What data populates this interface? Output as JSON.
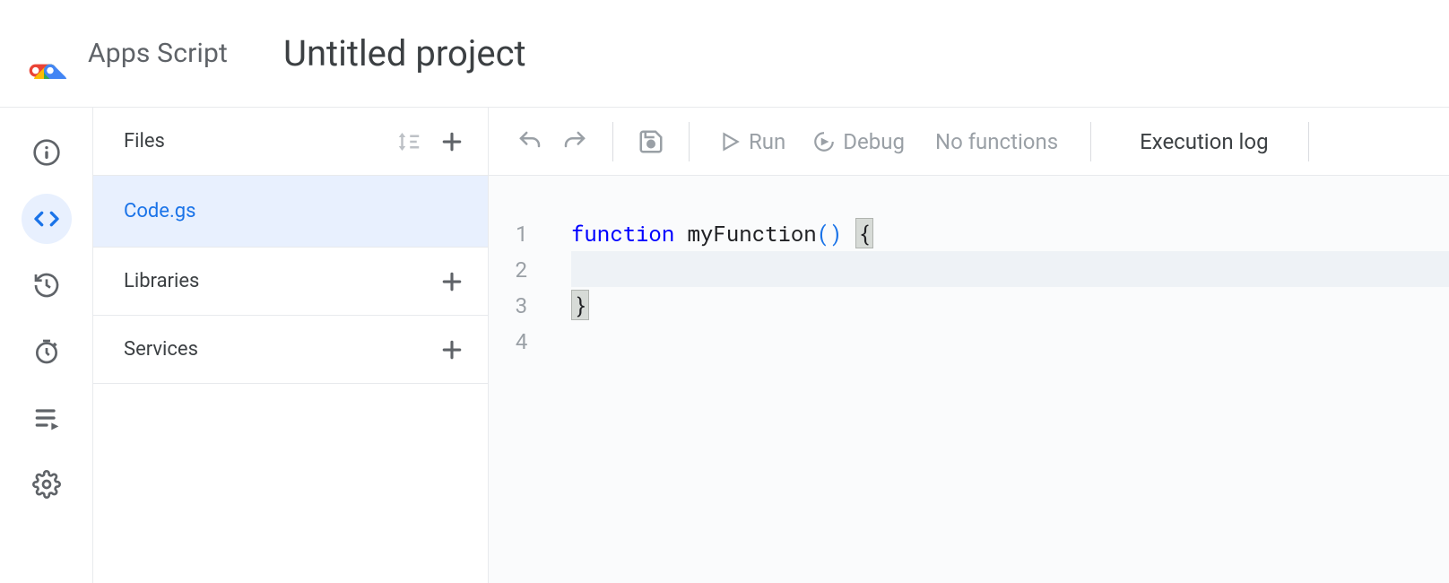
{
  "header": {
    "app_name": "Apps Script",
    "project_title": "Untitled project"
  },
  "nav": {
    "items": [
      "overview",
      "editor",
      "history",
      "triggers",
      "executions",
      "settings"
    ],
    "active": "editor"
  },
  "sidebar": {
    "files_label": "Files",
    "libraries_label": "Libraries",
    "services_label": "Services",
    "files": [
      {
        "name": "Code.gs",
        "selected": true
      }
    ]
  },
  "toolbar": {
    "run_label": "Run",
    "debug_label": "Debug",
    "function_select": "No functions",
    "execution_log_label": "Execution log"
  },
  "editor": {
    "line_numbers": [
      "1",
      "2",
      "3",
      "4"
    ],
    "code": {
      "line1_keyword": "function",
      "line1_name": " myFunction",
      "line1_parens": "()",
      "line1_brace_open": "{",
      "line2_indent": "  ",
      "line3_brace_close": "}",
      "current_line": 2
    }
  }
}
